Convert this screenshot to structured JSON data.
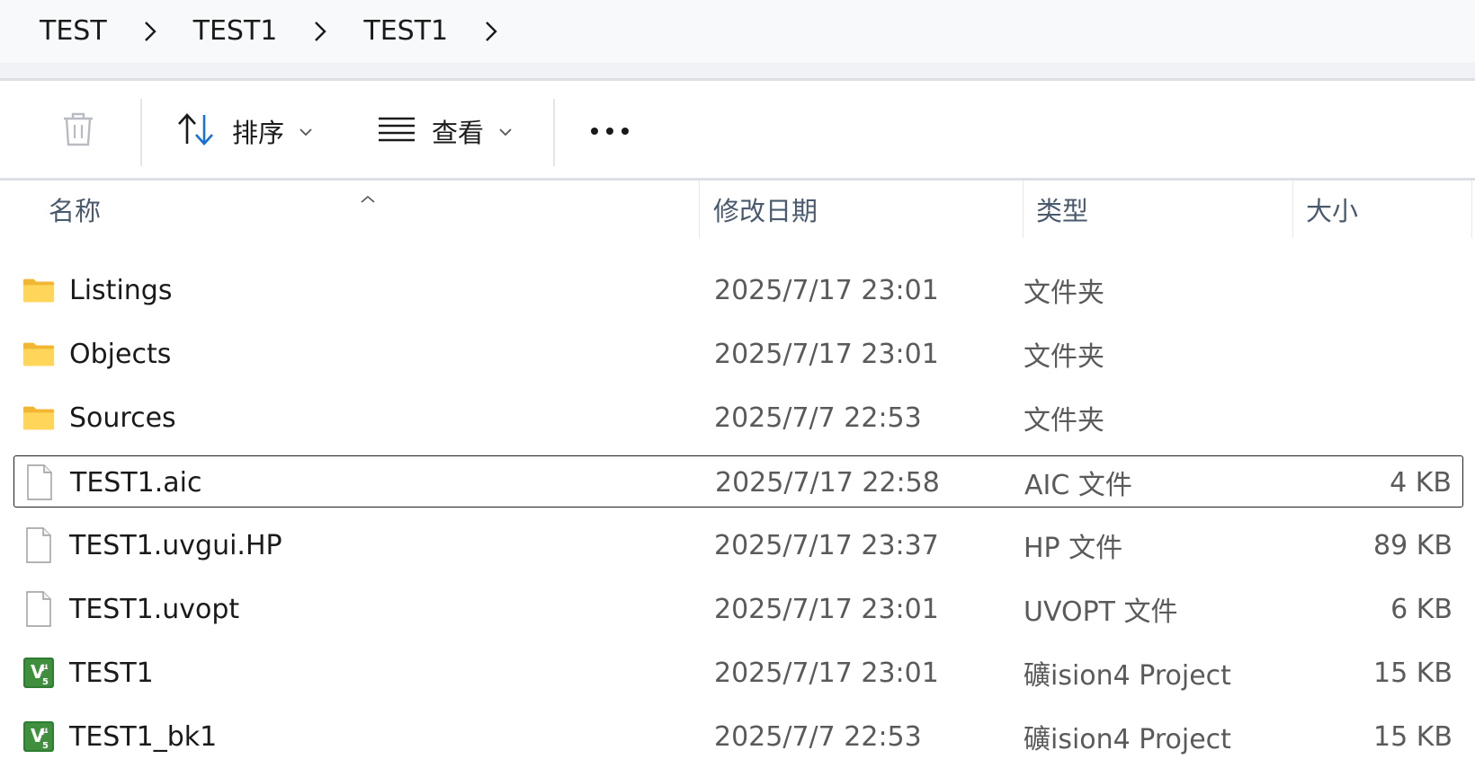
{
  "breadcrumb": {
    "items": [
      {
        "label": "TEST"
      },
      {
        "label": "TEST1"
      },
      {
        "label": "TEST1"
      }
    ]
  },
  "toolbar": {
    "delete_icon": "trash-icon",
    "sort_label": "排序",
    "sort_icon": "sort-arrows-icon",
    "view_label": "查看",
    "view_icon": "list-lines-icon",
    "more_icon": "more-dots-icon"
  },
  "columns": {
    "name": "名称",
    "modified": "修改日期",
    "type": "类型",
    "size": "大小",
    "sorted_by": "name"
  },
  "colors": {
    "folder": "#f5c542",
    "selected_border": "#1f1f1f",
    "header_text": "#4a5a6e",
    "secondary_text": "#5a5a5a",
    "uvision_green": "#2e7d32"
  },
  "files": [
    {
      "name": "Listings",
      "modified": "2025/7/17 23:01",
      "type": "文件夹",
      "size": "",
      "icon": "folder-icon",
      "selected": false
    },
    {
      "name": "Objects",
      "modified": "2025/7/17 23:01",
      "type": "文件夹",
      "size": "",
      "icon": "folder-icon",
      "selected": false
    },
    {
      "name": "Sources",
      "modified": "2025/7/7 22:53",
      "type": "文件夹",
      "size": "",
      "icon": "folder-icon",
      "selected": false
    },
    {
      "name": "TEST1.aic",
      "modified": "2025/7/17 22:58",
      "type": "AIC 文件",
      "size": "4 KB",
      "icon": "file-icon",
      "selected": true
    },
    {
      "name": "TEST1.uvgui.HP",
      "modified": "2025/7/17 23:37",
      "type": "HP 文件",
      "size": "89 KB",
      "icon": "file-icon",
      "selected": false
    },
    {
      "name": "TEST1.uvopt",
      "modified": "2025/7/17 23:01",
      "type": "UVOPT 文件",
      "size": "6 KB",
      "icon": "file-icon",
      "selected": false
    },
    {
      "name": "TEST1",
      "modified": "2025/7/17 23:01",
      "type": "礦ision4 Project",
      "size": "15 KB",
      "icon": "uvision-project-icon",
      "selected": false
    },
    {
      "name": "TEST1_bk1",
      "modified": "2025/7/7 22:53",
      "type": "礦ision4 Project",
      "size": "15 KB",
      "icon": "uvision-project-icon",
      "selected": false
    }
  ]
}
